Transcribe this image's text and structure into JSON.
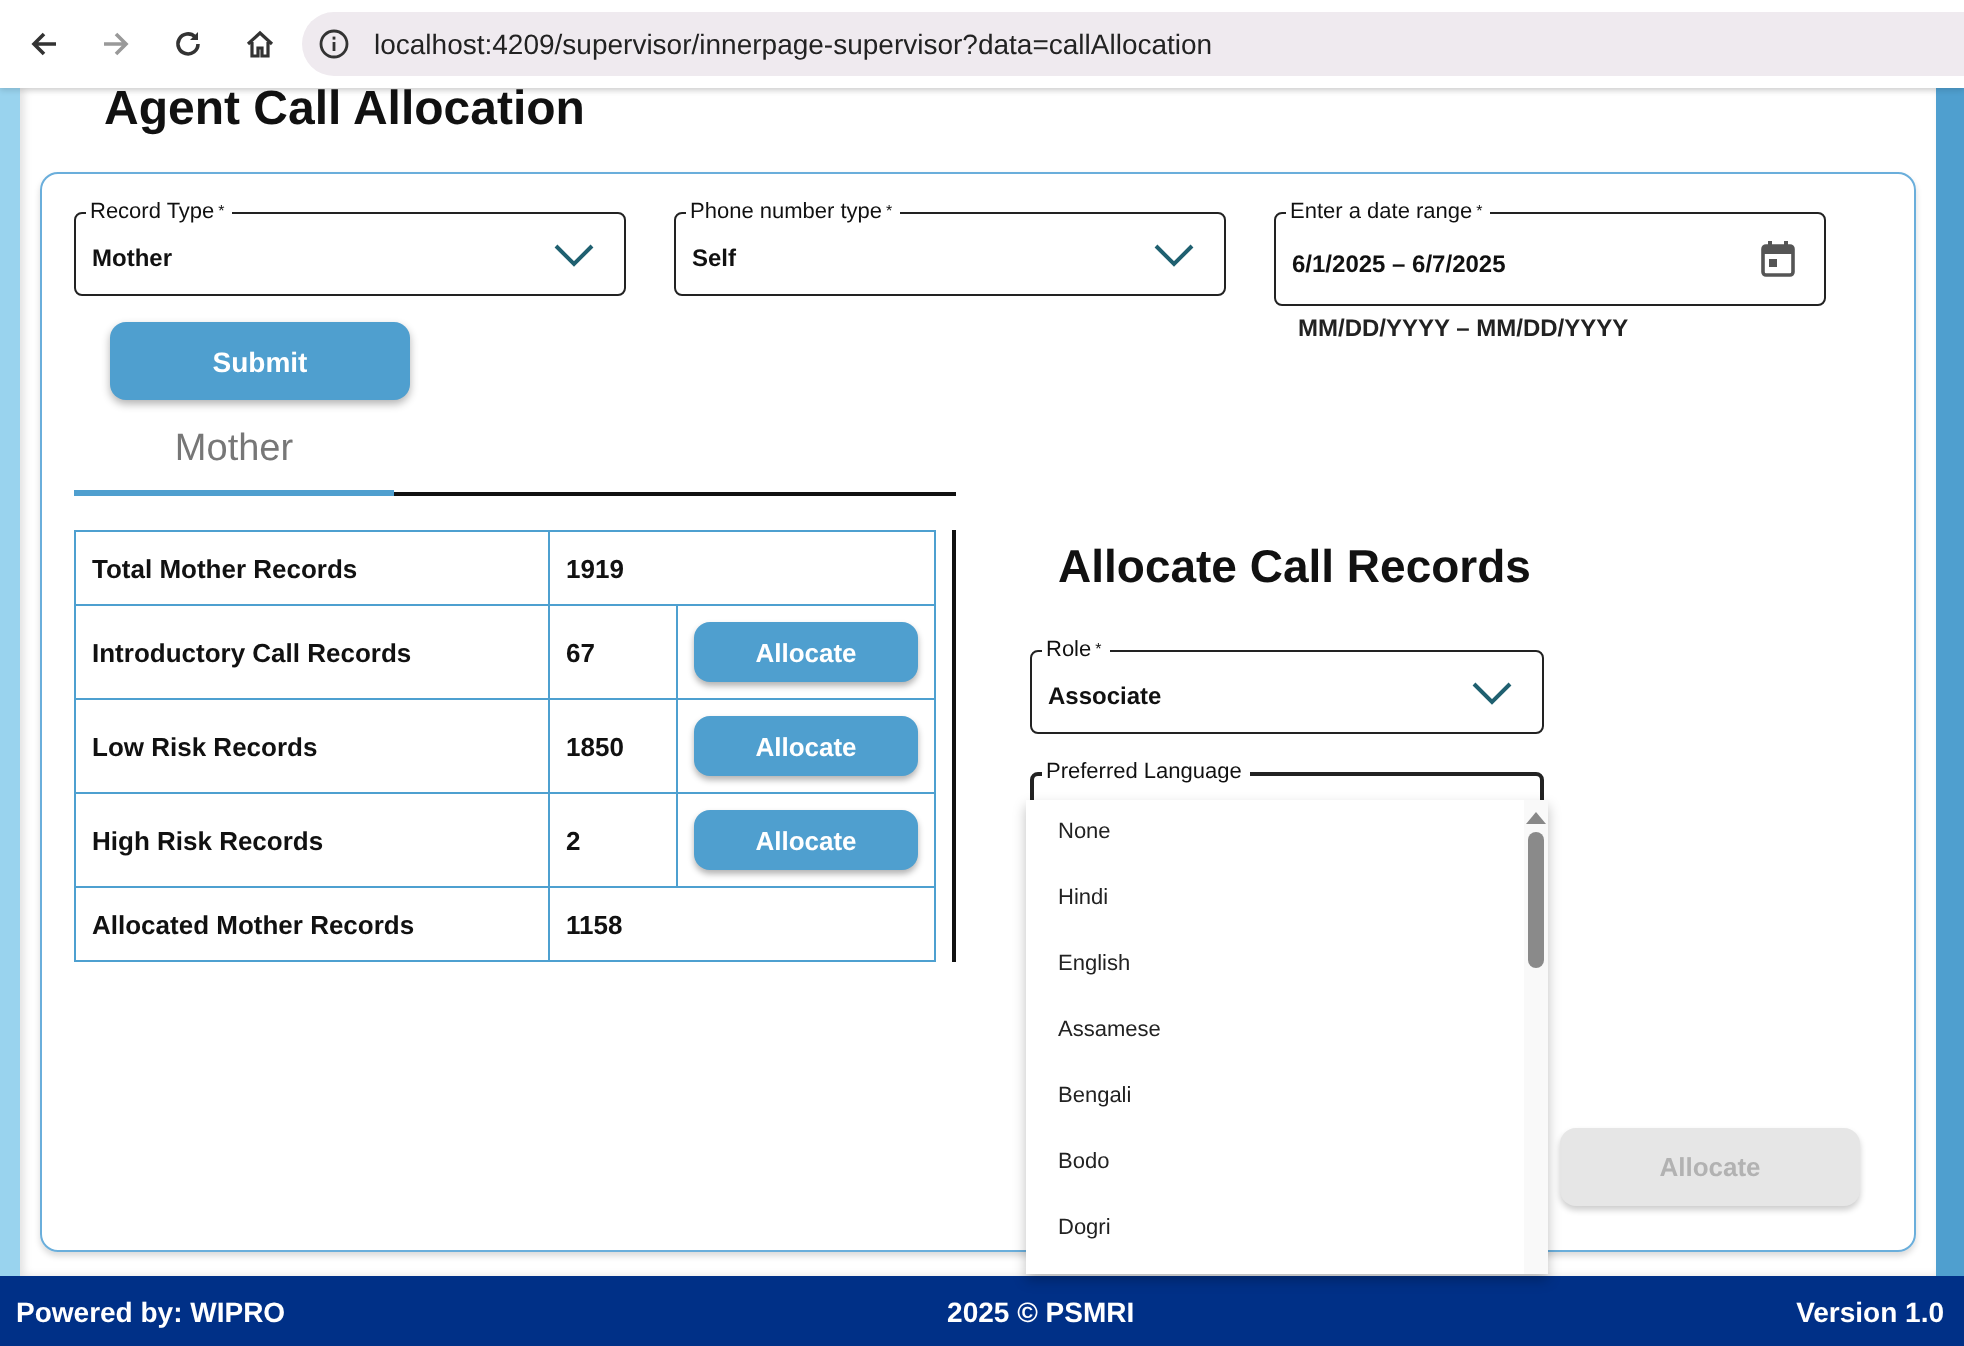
{
  "browser": {
    "url": "localhost:4209/supervisor/innerpage-supervisor?data=callAllocation"
  },
  "page_title": "Agent Call Allocation",
  "filters": [
    {
      "kind": "select",
      "label": "Record Type",
      "marker": "*",
      "value": "Mother"
    },
    {
      "kind": "select",
      "label": "Phone number type",
      "marker": "*",
      "value": "Self"
    },
    {
      "kind": "date",
      "label": "Enter a date range",
      "marker": "*",
      "value": "6/1/2025  –  6/7/2025",
      "hint": "MM/DD/YYYY – MM/DD/YYYY"
    }
  ],
  "submit_button": "Submit",
  "tabs": [
    {
      "label": "Mother",
      "selected": true
    }
  ],
  "records": [
    {
      "label": "Total Mother Records",
      "count": "1919"
    },
    {
      "label": "Introductory Call Records",
      "count": "67",
      "action": "Allocate"
    },
    {
      "label": "Low Risk Records",
      "count": "1850",
      "action": "Allocate"
    },
    {
      "label": "High Risk Records",
      "count": "2",
      "action": "Allocate"
    },
    {
      "label": "Allocated Mother Records",
      "count": "1158"
    }
  ],
  "allocate_panel": {
    "heading": "Allocate Call Records",
    "role": {
      "label": "Role",
      "marker": "*",
      "value": "Associate"
    },
    "language": {
      "label": "Preferred Language",
      "expanded": true,
      "options": [
        "None",
        "Hindi",
        "English",
        "Assamese",
        "Bengali",
        "Bodo",
        "Dogri"
      ]
    },
    "allocate_button": {
      "label": "Allocate",
      "disabled": true
    }
  },
  "footer": {
    "left": "Powered by: WIPRO",
    "center": "2025 © PSMRI",
    "right": "Version 1.0"
  }
}
